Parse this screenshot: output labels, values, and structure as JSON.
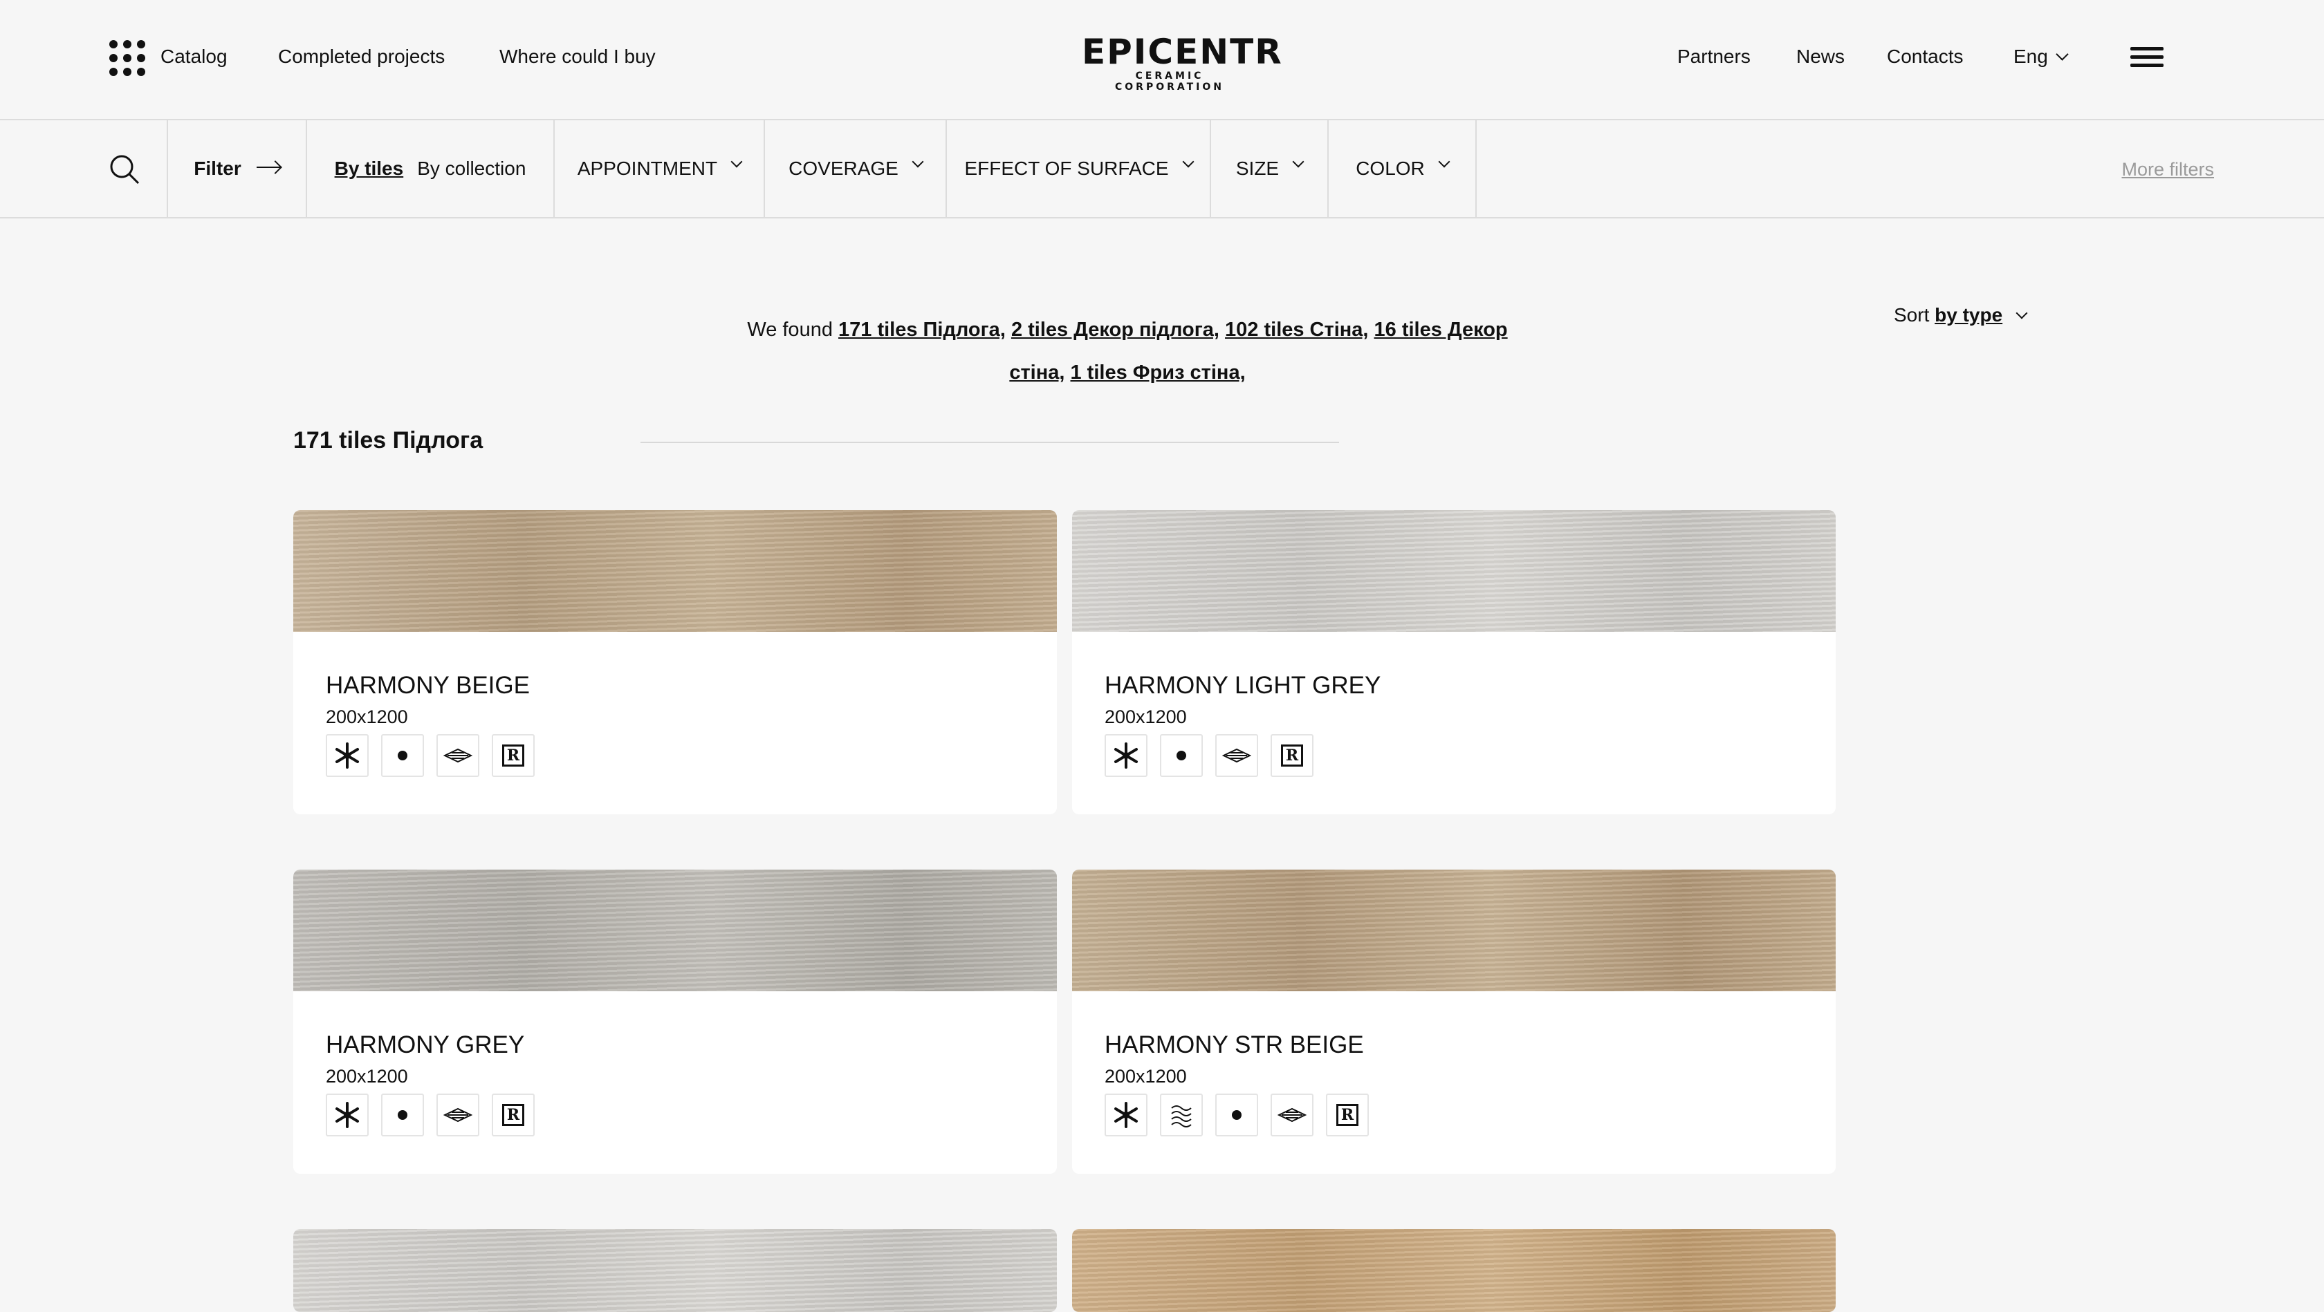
{
  "header": {
    "catalog": "Catalog",
    "completed_projects": "Completed projects",
    "where_buy": "Where could I buy",
    "logo_main": "EPICENTR",
    "logo_sub": "CERAMIC CORPORATION",
    "partners": "Partners",
    "news": "News",
    "contacts": "Contacts",
    "language": "Eng"
  },
  "filterbar": {
    "filter": "Filter",
    "by_tiles": "By tiles",
    "by_collection": "By collection",
    "appointment": "APPOINTMENT",
    "coverage": "COVERAGE",
    "effect_of_surface": "EFFECT OF SURFACE",
    "size": "SIZE",
    "color": "COLOR",
    "more_filters": "More filters"
  },
  "results": {
    "found_prefix": "We found",
    "found_links": [
      "171 tiles Підлога,",
      "2 tiles Декор підлога,",
      "102 tiles Стіна,",
      "16 tiles Декор стіна,",
      "1 tiles Фриз стіна,"
    ],
    "sort_label": "Sort",
    "sort_value": "by type",
    "section_title": "171 tiles Підлога"
  },
  "products": [
    {
      "name": "HARMONY BEIGE",
      "size": "200x1200",
      "icons": [
        "snowflake-icon",
        "dot-icon",
        "pattern-icon",
        "r-icon"
      ]
    },
    {
      "name": "HARMONY LIGHT GREY",
      "size": "200x1200",
      "icons": [
        "snowflake-icon",
        "dot-icon",
        "pattern-icon",
        "r-icon"
      ]
    },
    {
      "name": "HARMONY GREY",
      "size": "200x1200",
      "icons": [
        "snowflake-icon",
        "dot-icon",
        "pattern-icon",
        "r-icon"
      ]
    },
    {
      "name": "HARMONY STR BEIGE",
      "size": "200x1200",
      "icons": [
        "snowflake-icon",
        "structure-icon",
        "dot-icon",
        "pattern-icon",
        "r-icon"
      ]
    }
  ],
  "icon_glyph_r": "R",
  "colors": {
    "background": "#f6f6f6",
    "text": "#111111",
    "muted": "#9a9a9a",
    "divider": "#dcdcdc"
  }
}
